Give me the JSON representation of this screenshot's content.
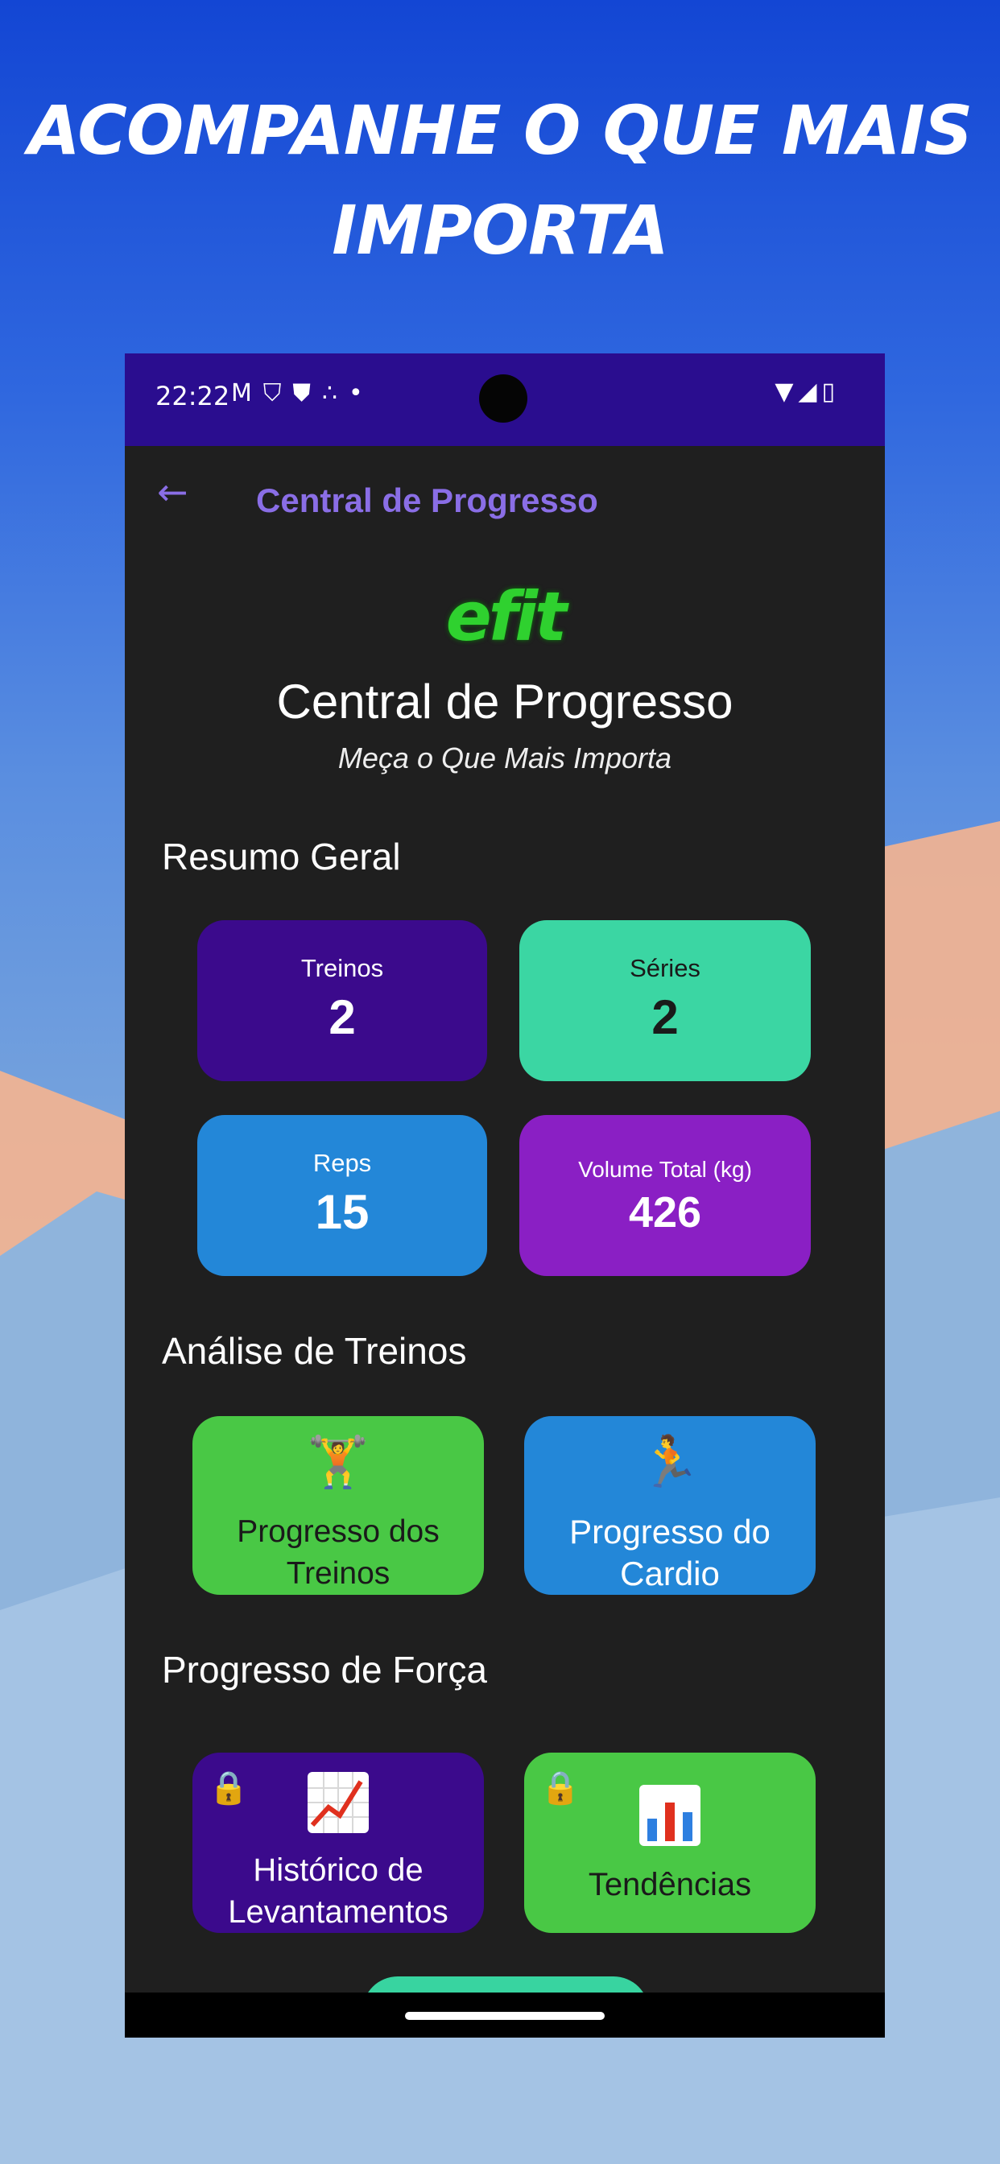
{
  "headline": [
    "ACOMPANHE O QUE MAIS",
    "IMPORTA"
  ],
  "status_bar": {
    "time": "22:22",
    "left_icons": [
      "gmail-icon",
      "shield-outline-icon",
      "shield-icon",
      "share-icon",
      "dot-icon"
    ],
    "right_icons": [
      "wifi-icon",
      "signal-icon",
      "battery-icon"
    ]
  },
  "app_bar": {
    "title": "Central de Progresso"
  },
  "header": {
    "logo_text": "efit",
    "title": "Central de Progresso",
    "subtitle": "Meça o Que Mais Importa"
  },
  "summary": {
    "section_title": "Resumo Geral",
    "cards": [
      {
        "label": "Treinos",
        "value": "2",
        "color": "#3b0a8c"
      },
      {
        "label": "Séries",
        "value": "2",
        "color": "#3bd6a3"
      },
      {
        "label": "Reps",
        "value": "15",
        "color": "#2387d8"
      },
      {
        "label": "Volume Total (kg)",
        "value": "426",
        "color": "#8a1fc4"
      }
    ]
  },
  "analysis": {
    "section_title": "Análise de Treinos",
    "cards": [
      {
        "icon": "weightlifter-icon",
        "label_lines": [
          "Progresso dos",
          "Treinos"
        ],
        "color": "#49c845"
      },
      {
        "icon": "runner-icon",
        "label_lines": [
          "Progresso do",
          "Cardio"
        ],
        "color": "#2387d8"
      }
    ]
  },
  "strength": {
    "section_title": "Progresso de Força",
    "cards": [
      {
        "icon": "chart-increasing-icon",
        "locked": true,
        "label_lines": [
          "Histórico de",
          "Levantamentos"
        ],
        "color": "#3b0a8c"
      },
      {
        "icon": "bar-chart-icon",
        "locked": true,
        "label_lines": [
          "Tendências"
        ],
        "color": "#49c845"
      }
    ]
  }
}
